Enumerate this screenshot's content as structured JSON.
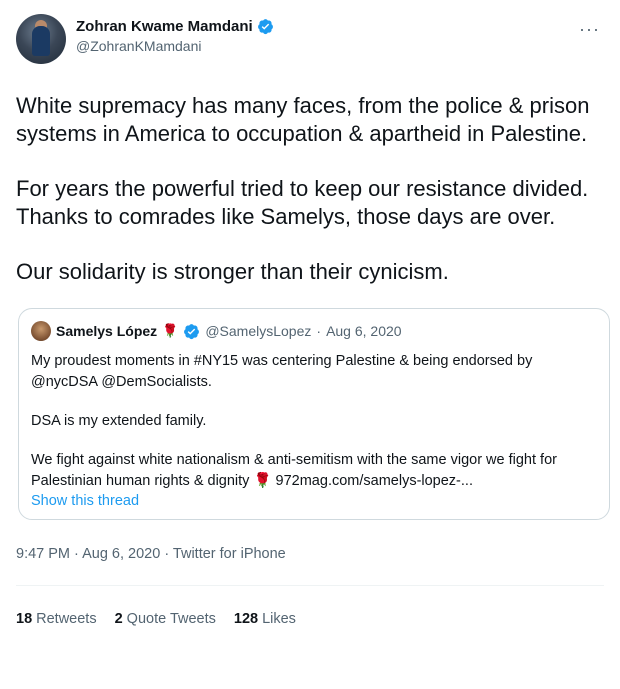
{
  "author": {
    "display_name": "Zohran Kwame Mamdani",
    "handle": "@ZohranKMamdani",
    "verified": true
  },
  "tweet": {
    "paragraphs": [
      "White supremacy has many faces, from the police & prison systems in America to occupation & apartheid in Palestine.",
      "For years the powerful tried to keep our resistance divided. Thanks to comrades like Samelys, those days are over.",
      "Our solidarity is stronger than their cynicism."
    ]
  },
  "quoted": {
    "name": "Samelys López",
    "handle": "@SamelysLopez",
    "separator": "·",
    "date": "Aug 6, 2020",
    "paragraphs": [
      "My proudest moments in #NY15 was centering Palestine & being endorsed by @nycDSA @DemSocialists.",
      "DSA is my extended family.",
      "We fight against white nationalism & anti-semitism with the same vigor we fight for Palestinian human rights & dignity 🌹 972mag.com/samelys-lopez-..."
    ],
    "show_thread": "Show this thread"
  },
  "meta": "9:47 PM · Aug 6, 2020 · Twitter for iPhone",
  "stats": [
    {
      "count": "18",
      "label": "Retweets"
    },
    {
      "count": "2",
      "label": "Quote Tweets"
    },
    {
      "count": "128",
      "label": "Likes"
    }
  ],
  "colors": {
    "accent": "#1d9bf0",
    "text": "#0f1419",
    "secondary": "#536471",
    "border": "#cfd9de",
    "rose": "#c0132b"
  },
  "icons": {
    "verified": "verified-badge-icon",
    "more": "more-options-icon",
    "rose": "rose-icon"
  }
}
